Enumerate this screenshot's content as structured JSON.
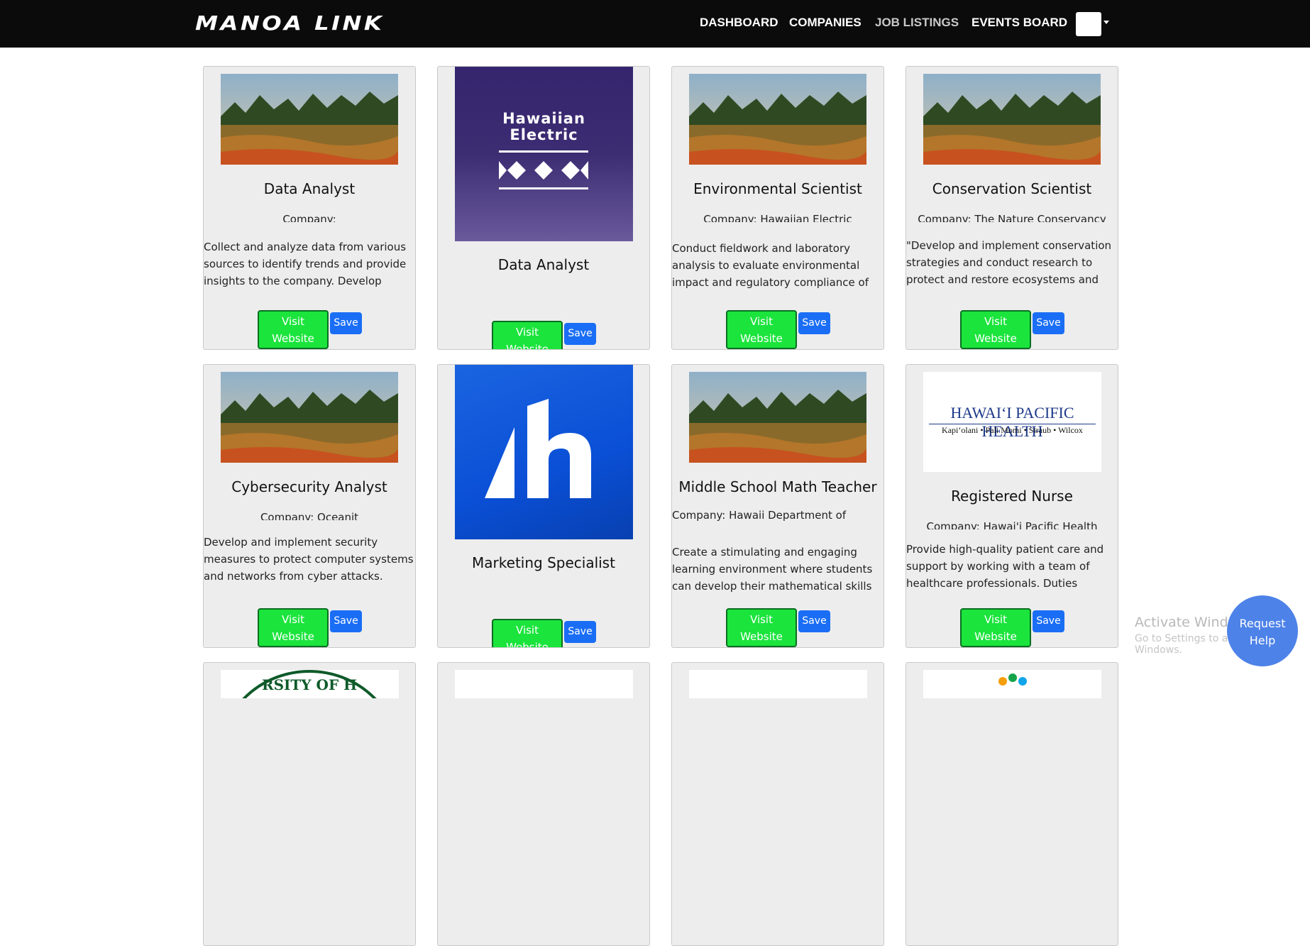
{
  "nav": {
    "brand": "MANOA LINK",
    "links": [
      "DASHBOARD",
      "COMPANIES",
      "JOB LISTINGS",
      "EVENTS BOARD"
    ]
  },
  "cards": [
    {
      "title": "Data Analyst",
      "company": "Company:",
      "description": "Collect and analyze data from various sources to identify trends and provide insights to the company. Develop",
      "visit": "Visit Website",
      "save": "Save",
      "image": "landscape-photo"
    },
    {
      "title": "Data Analyst",
      "company": "",
      "description": "",
      "visit": "Visit Website",
      "save": "Save",
      "image": "hawaiian-electric-logo",
      "logo_text": [
        "Hawaiian",
        "Electric"
      ]
    },
    {
      "title": "Environmental Scientist",
      "company": "Company: Hawaiian Electric",
      "description": "Conduct fieldwork and laboratory analysis to evaluate environmental impact and regulatory compliance of energy",
      "visit": "Visit Website",
      "save": "Save",
      "image": "landscape-photo"
    },
    {
      "title": "Conservation Scientist",
      "company": "Company: The Nature Conservancy",
      "description": "\"Develop and implement conservation strategies and conduct research to protect and restore ecosystems and",
      "visit": "Visit Website",
      "save": "Save",
      "image": "landscape-photo"
    },
    {
      "title": "Cybersecurity Analyst",
      "company": "Company: Oceanit",
      "description": "Develop and implement security measures to protect computer systems and networks from cyber attacks. Conduct",
      "visit": "Visit Website",
      "save": "Save",
      "image": "landscape-photo"
    },
    {
      "title": "Marketing Specialist",
      "company": "",
      "description": "",
      "visit": "Visit Website",
      "save": "Save",
      "image": "h-logo"
    },
    {
      "title": "Middle School Math Teacher",
      "company": "Company: Hawaii Department of",
      "description": "Create a stimulating and engaging learning environment where students can develop their mathematical skills and",
      "visit": "Visit Website",
      "save": "Save",
      "image": "landscape-photo"
    },
    {
      "title": "Registered Nurse",
      "company": "Company: Hawai'i Pacific Health",
      "description": "Provide high-quality patient care and support by working with a team of healthcare professionals. Duties include",
      "visit": "Visit Website",
      "save": "Save",
      "image": "hawaii-pacific-health-logo",
      "logo_text": [
        "HAWAIʻI PACIFIC HEALTH",
        "Kapiʻolani • Pali Momi • Straub • Wilcox"
      ]
    }
  ],
  "bottom_row": [
    {
      "image": "university-seal",
      "seal_text": "RSITY OF H"
    },
    {
      "image": "blank"
    },
    {
      "image": "blank"
    },
    {
      "image": "colorful-logo"
    }
  ],
  "watermark": {
    "line1": "Activate Windows",
    "line2": "Go to Settings to activate Windows."
  },
  "help_button": [
    "Request",
    "Help"
  ],
  "colors": {
    "nav_bg": "#0b0b0b",
    "visit_green": "#1be43c",
    "save_blue": "#1a6ef5",
    "help_blue": "#4d82e8",
    "he_purple": "#3a2a6e",
    "h_blue": "#0a4fd6"
  }
}
